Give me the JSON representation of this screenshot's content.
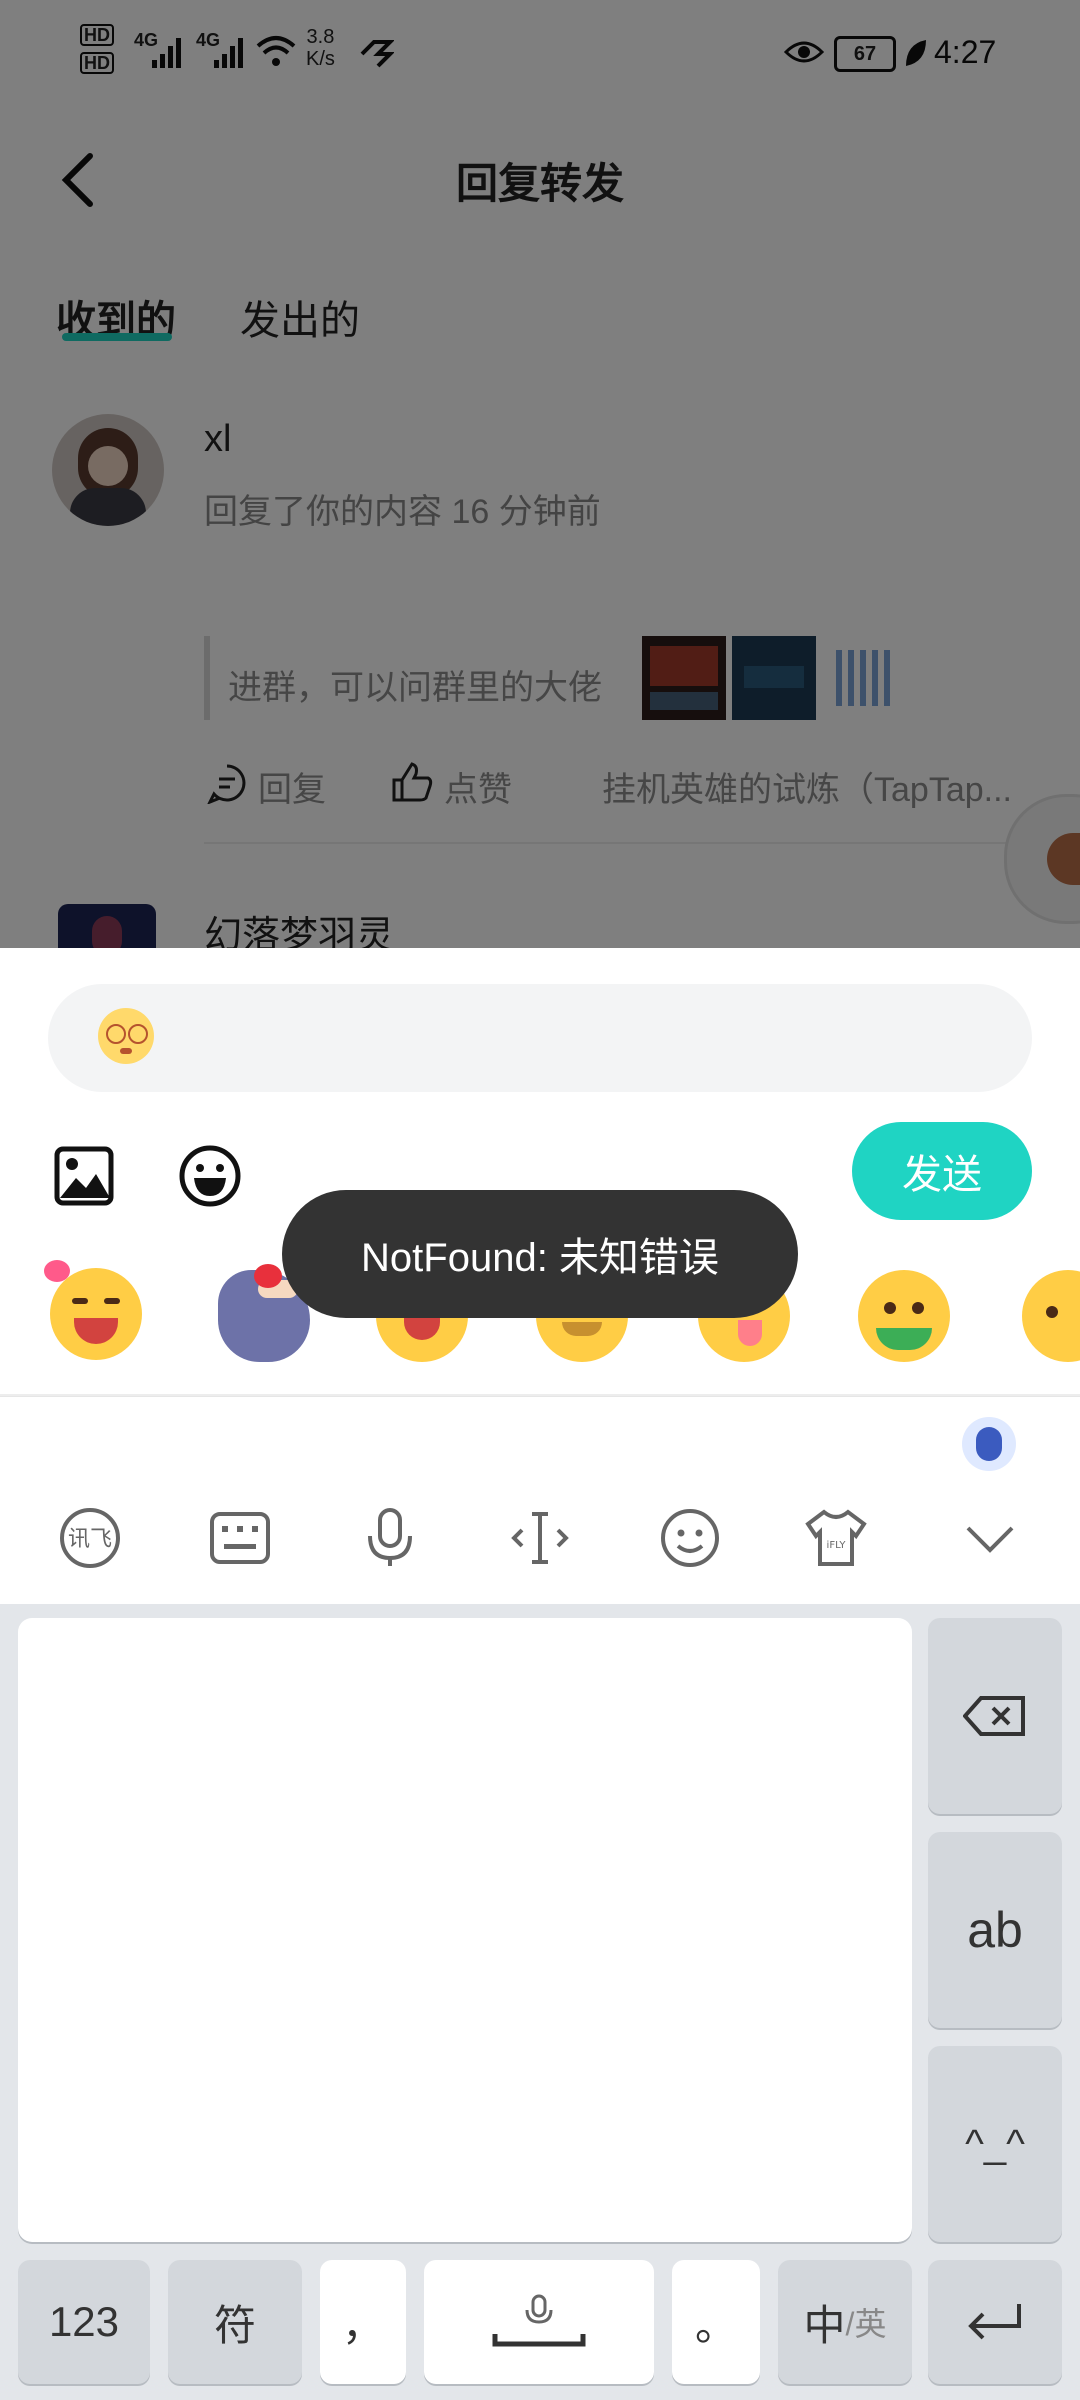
{
  "status_bar": {
    "hd1": "HD",
    "hd2": "HD",
    "net1": "4G",
    "net2": "4G",
    "speed_value": "3.8",
    "speed_unit": "K/s",
    "battery": "67",
    "time": "4:27"
  },
  "header": {
    "title": "回复转发"
  },
  "tabs": [
    {
      "label": "收到的",
      "active": true
    },
    {
      "label": "发出的",
      "active": false
    }
  ],
  "messages": [
    {
      "username": "xl",
      "meta": "回复了你的内容 16 分钟前",
      "quote": "进群，可以问群里的大佬",
      "actions": {
        "reply": "回复",
        "like": "点赞"
      },
      "source": "挂机英雄的试炼（TapTap..."
    },
    {
      "username": "幻落梦羽灵"
    }
  ],
  "composer": {
    "send_label": "发送"
  },
  "toast": {
    "text": "NotFound: 未知错误"
  },
  "keyboard": {
    "numbers_key": "123",
    "symbols_key": "符",
    "comma_key": "，",
    "period_key": "。",
    "lang_key_main": "中",
    "lang_key_sub": "/英",
    "ab_key": "ab",
    "face_key": "^_^",
    "toolbar_brand": "iFLY"
  },
  "colors": {
    "accent": "#1fd4c3",
    "toast_bg": "#333333",
    "keyboard_bg": "#e3e6ea"
  }
}
